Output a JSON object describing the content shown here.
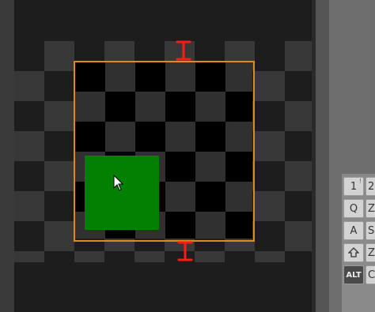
{
  "colors": {
    "selection_frame": "#e08a1e",
    "sprite_fill": "#028002",
    "resize_handle": "#ff1a1a"
  },
  "keyboard": {
    "row1": {
      "key": "1",
      "sub": "!",
      "next": "2"
    },
    "row2": {
      "key": "Q",
      "next": "Z"
    },
    "row3": {
      "key": "A",
      "next": "S"
    },
    "row4": {
      "icon": "shift-arrow-icon",
      "next": "Z"
    },
    "row5": {
      "key": "ALT",
      "next": "C"
    }
  }
}
